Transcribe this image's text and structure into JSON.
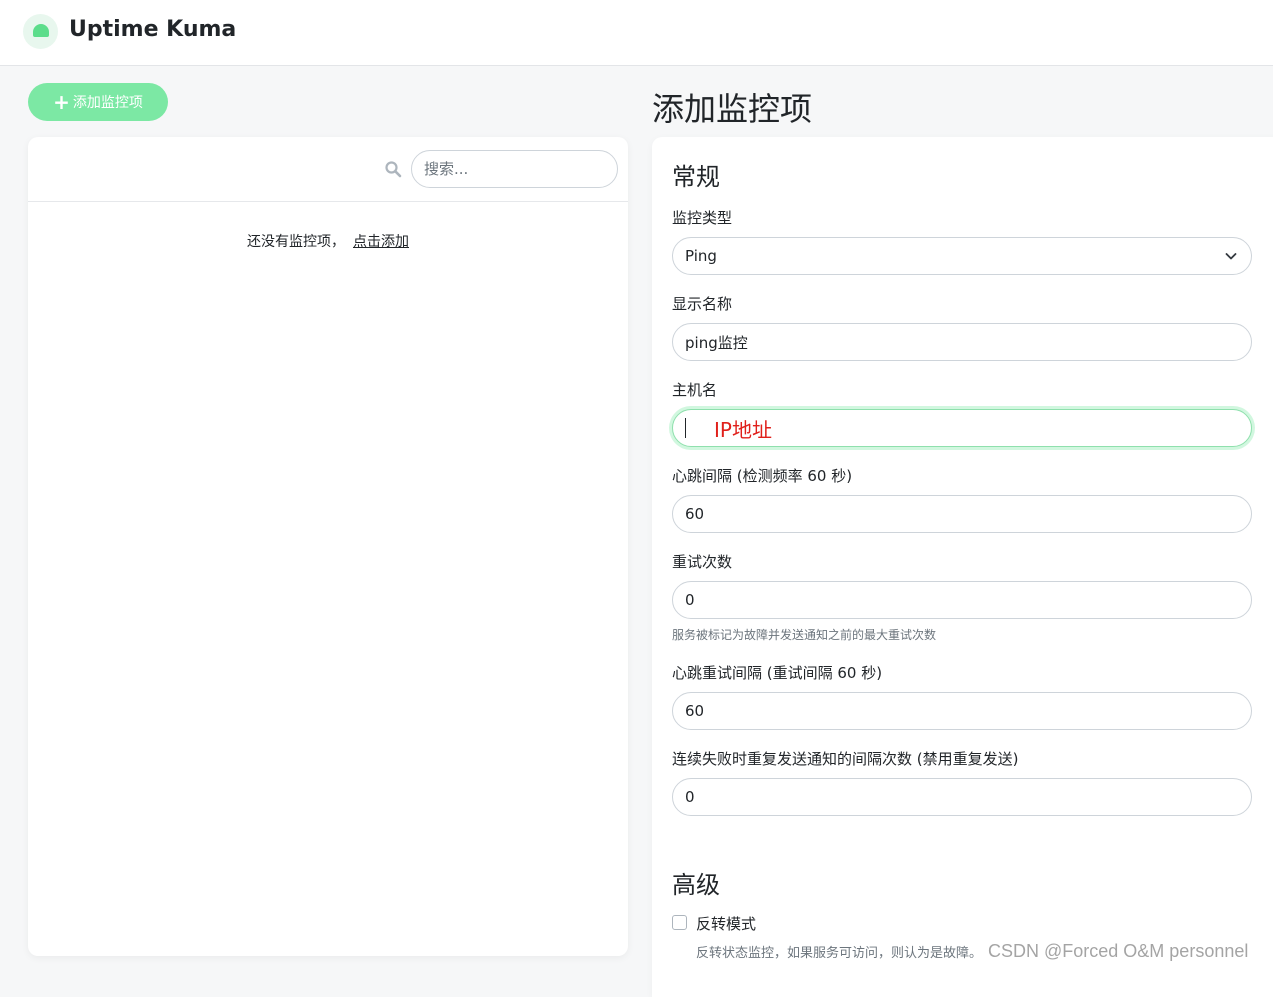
{
  "app": {
    "title": "Uptime Kuma"
  },
  "sidebar": {
    "add_button_label": "添加监控项",
    "search": {
      "placeholder": "搜索...",
      "value": ""
    },
    "empty_text": "还没有监控项，",
    "empty_link": "点击添加"
  },
  "main": {
    "page_title": "添加监控项",
    "general": {
      "title": "常规",
      "monitor_type": {
        "label": "监控类型",
        "value": "Ping"
      },
      "display_name": {
        "label": "显示名称",
        "value": "ping监控"
      },
      "hostname": {
        "label": "主机名",
        "value": "",
        "annotation": "IP地址"
      },
      "heartbeat_interval": {
        "label": "心跳间隔 (检测频率 60 秒)",
        "value": "60"
      },
      "retries": {
        "label": "重试次数",
        "value": "0",
        "help": "服务被标记为故障并发送通知之前的最大重试次数"
      },
      "retry_interval": {
        "label": "心跳重试间隔 (重试间隔 60 秒)",
        "value": "60"
      },
      "resend_interval": {
        "label": "连续失败时重复发送通知的间隔次数 (禁用重复发送)",
        "value": "0"
      }
    },
    "advanced": {
      "title": "高级",
      "upside_down": {
        "label": "反转模式",
        "checked": false,
        "help": "反转状态监控，如果服务可访问，则认为是故障。"
      }
    }
  },
  "watermark": "CSDN @Forced O&M personnel",
  "colors": {
    "accent": "#7ce8a4",
    "annotation": "#e0201b"
  }
}
